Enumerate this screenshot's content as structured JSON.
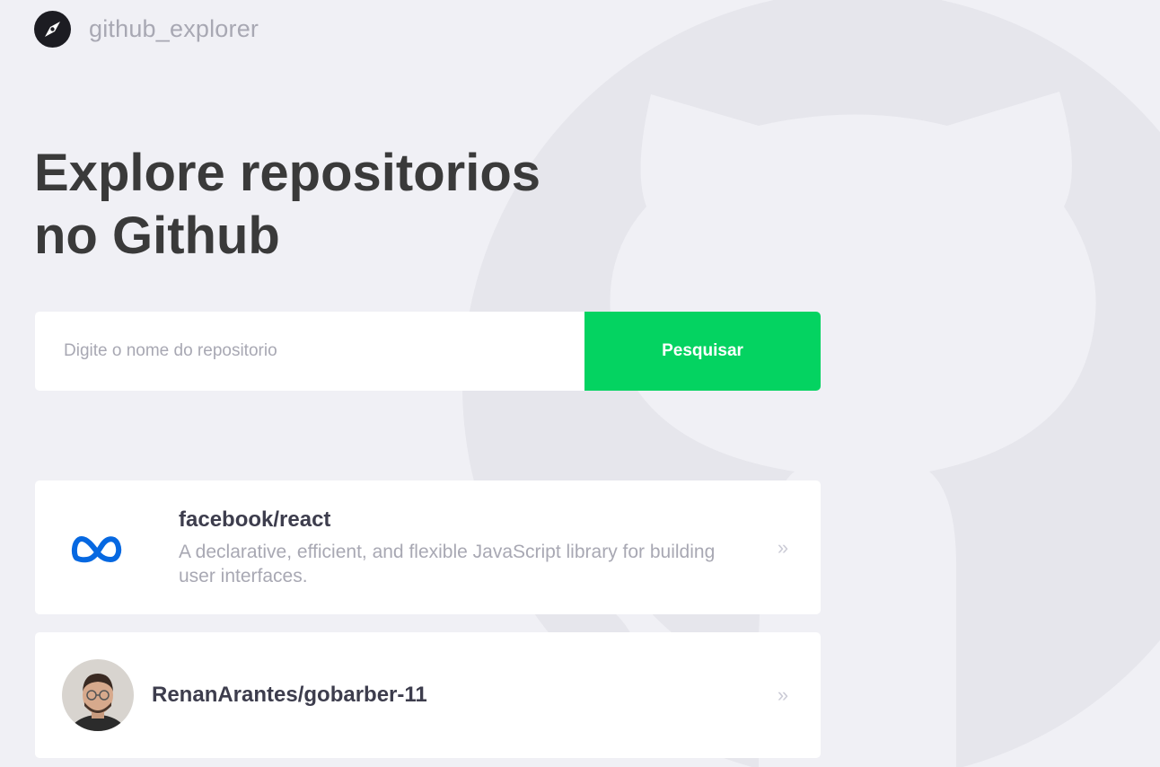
{
  "header": {
    "logo_icon": "compass-icon",
    "brand": "github_explorer"
  },
  "background_icon": "github-octocat-icon",
  "hero": {
    "title_line1": "Explore repositorios",
    "title_line2": "no Github"
  },
  "search": {
    "placeholder": "Digite o nome do repositorio",
    "value": "",
    "button_label": "Pesquisar"
  },
  "repositories": [
    {
      "name": "facebook/react",
      "description": "A declarative, efficient, and flexible JavaScript library for building user interfaces.",
      "avatar_icon": "meta-logo-icon"
    },
    {
      "name": "RenanArantes/gobarber-11",
      "description": "",
      "avatar_icon": "user-avatar"
    }
  ],
  "chevron_icon": "double-chevron-right-icon",
  "colors": {
    "background": "#f0f0f5",
    "accent": "#04d361",
    "title": "#3a3a3a",
    "muted": "#a8a8b3",
    "meta_blue": "#0668e1"
  }
}
